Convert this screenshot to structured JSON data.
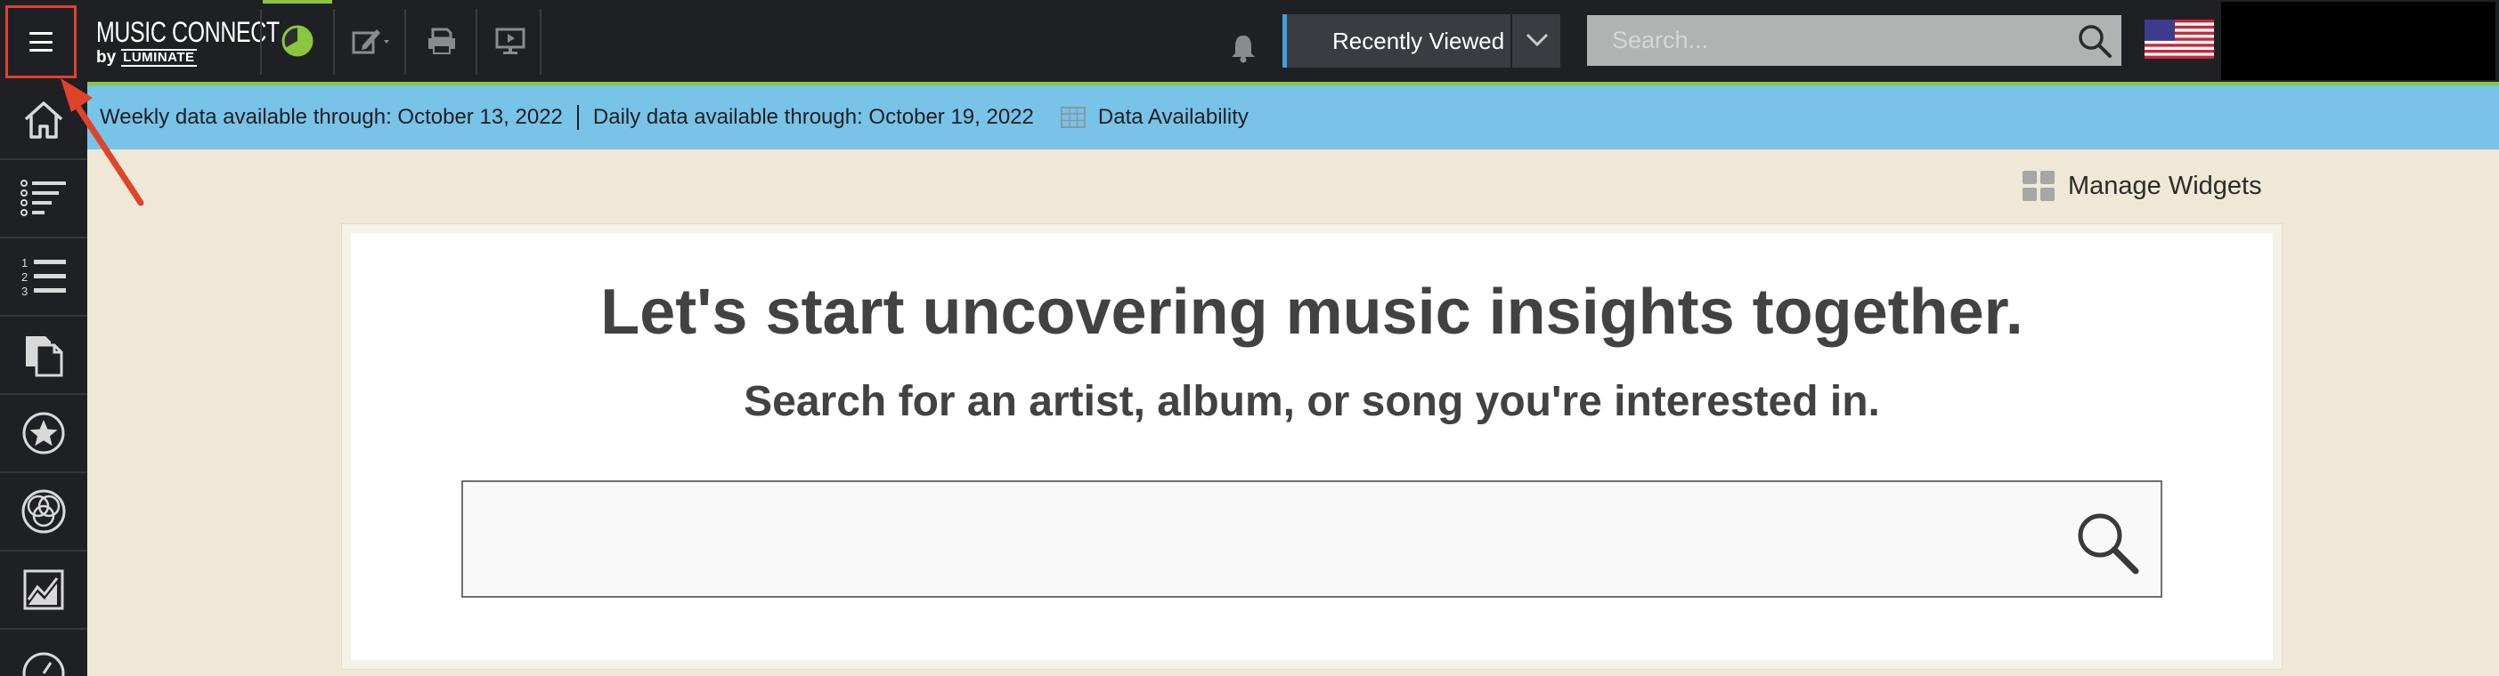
{
  "topbar": {
    "logo_line1": "MUSIC CONNECT",
    "logo_by": "by",
    "logo_brand": "LUMINATE",
    "recently_viewed": "Recently Viewed",
    "search_placeholder": "Search..."
  },
  "infobar": {
    "weekly": "Weekly data available through: October 13, 2022",
    "daily": "Daily data available through: October 19, 2022",
    "availability": "Data Availability"
  },
  "manage_widgets": "Manage Widgets",
  "card": {
    "title": "Let's start uncovering music insights together.",
    "subtitle": "Search for an artist, album, or song you're interested in.",
    "search_value": ""
  },
  "sidebar": {
    "items": [
      {
        "icon": "home-icon"
      },
      {
        "icon": "chart-list-icon"
      },
      {
        "icon": "ranked-list-icon"
      },
      {
        "icon": "documents-icon"
      },
      {
        "icon": "star-icon"
      },
      {
        "icon": "venn-icon"
      },
      {
        "icon": "trend-chart-icon"
      },
      {
        "icon": "gauge-icon"
      }
    ]
  },
  "colors": {
    "topbar": "#1f2024",
    "accent_green": "#8cc63f",
    "info_blue": "#78c3e8",
    "page_bg": "#efe8d6",
    "highlight_red": "#e1422a"
  }
}
